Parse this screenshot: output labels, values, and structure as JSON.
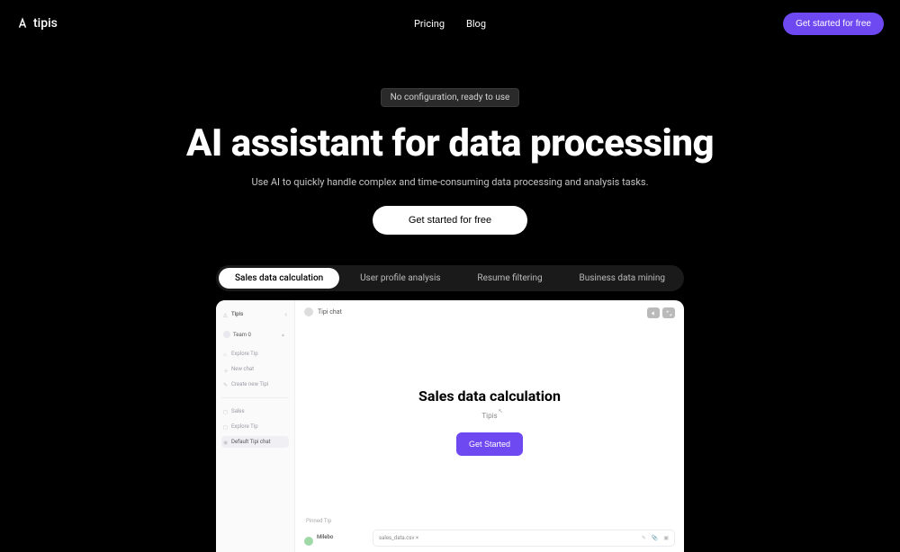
{
  "brand": "tipis",
  "nav": {
    "pricing": "Pricing",
    "blog": "Blog"
  },
  "header_cta": "Get started for free",
  "hero": {
    "badge": "No configuration, ready to use",
    "title": "AI assistant for data processing",
    "subtitle": "Use AI to quickly handle complex and time-consuming data processing and analysis tasks.",
    "cta": "Get started for free"
  },
  "tabs": [
    "Sales data calculation",
    "User profile analysis",
    "Resume filtering",
    "Business data mining"
  ],
  "app": {
    "sidebar": {
      "workspace": "Tipis",
      "team": "Team 0",
      "items": [
        "Explore Tip",
        "New chat",
        "Create new Tipi"
      ],
      "recent": [
        "Sales",
        "Explore Tip",
        "Default Tipi chat"
      ]
    },
    "chat_title": "Tipi chat",
    "demo": {
      "title": "Sales data calculation",
      "brand": "Tipis",
      "cta": "Get Started"
    },
    "bottom": {
      "pinned": "Pinned Tip",
      "user_name": "Milebo",
      "file_chip": "sales_data.csv ×"
    }
  }
}
